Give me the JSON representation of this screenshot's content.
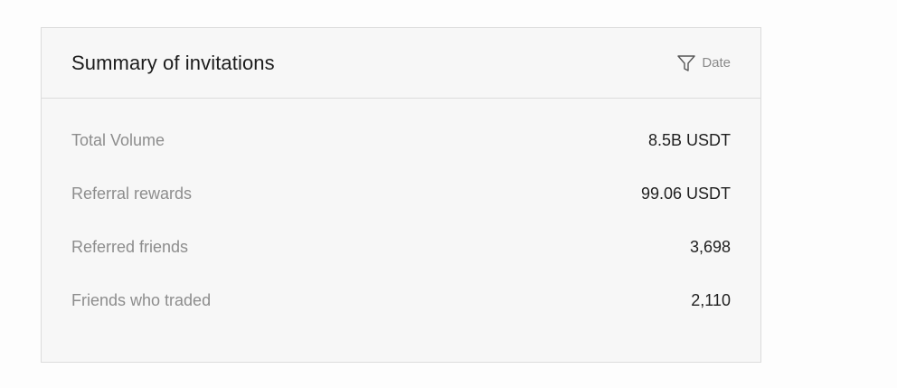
{
  "summary": {
    "title": "Summary of invitations",
    "filter_label": "Date",
    "filter_icon": "filter-icon",
    "rows": [
      {
        "label": "Total Volume",
        "value": "8.5B USDT"
      },
      {
        "label": "Referral rewards",
        "value": "99.06 USDT"
      },
      {
        "label": "Referred friends",
        "value": "3,698"
      },
      {
        "label": "Friends who traded",
        "value": "2,110"
      }
    ]
  }
}
